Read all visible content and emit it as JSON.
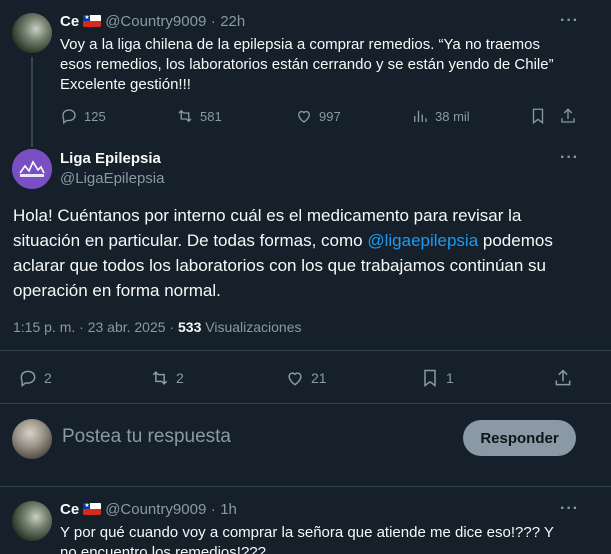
{
  "tweet1": {
    "name": "Ce",
    "handle": "@Country9009",
    "sep": "·",
    "time": "22h",
    "text_line1": "Voy a la liga chilena de la epilepsia a comprar remedios. “Ya no traemos",
    "text_line2": "esos remedios, los laboratorios están cerrando y se están yendo de Chile”",
    "text_line3": "Excelente gestión!!!",
    "replies": "125",
    "reposts": "581",
    "likes": "997",
    "views": "38 mil",
    "more": "···"
  },
  "tweet2": {
    "name": "Liga Epilepsia",
    "handle": "@LigaEpilepsia",
    "more": "···",
    "text_l1": "Hola! Cuéntanos por interno cuál es el medicamento para revisar la",
    "text_l2": "situación en particular. De todas formas, como ",
    "mention": "@ligaepilepsia",
    "text_l2b": " podemos",
    "text_l3": "aclarar que todos los laboratorios con los que trabajamos continúan su",
    "text_l4": "operación en forma normal.",
    "timestamp": "1:15 p. m. · 23 abr. 2025 · ",
    "views_count": "533",
    "views_label": " Visualizaciones",
    "replies": "2",
    "reposts": "2",
    "likes": "21",
    "bookmarks": "1"
  },
  "compose": {
    "placeholder": "Postea tu respuesta",
    "button": "Responder"
  },
  "tweet3": {
    "name": "Ce",
    "handle": "@Country9009",
    "sep": "·",
    "time": "1h",
    "text_line1": "Y por qué cuando voy a comprar la señora que atiende me dice eso!??? Y",
    "text_line2": "no encuentro los remedios!???",
    "more": "···"
  },
  "colors": {
    "background": "#15202b",
    "text": "#f7f9f9",
    "muted": "#8b98a5",
    "link": "#1d9bf0",
    "divider": "#38444d"
  }
}
